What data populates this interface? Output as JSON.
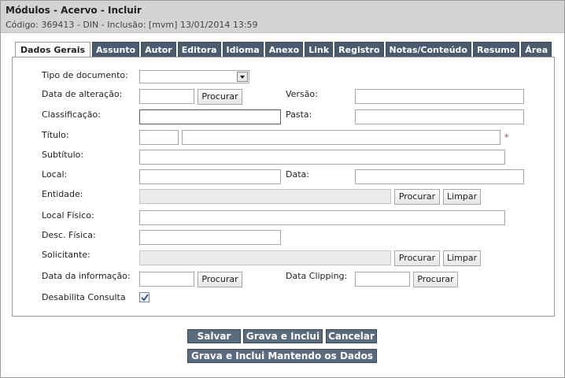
{
  "header": {
    "title": "Módulos - Acervo - Incluir",
    "subtitle": "Código: 369413 - DIN - Inclusão: [mvm] 13/01/2014 13:59"
  },
  "tabs": [
    {
      "label": "Dados Gerais",
      "active": true
    },
    {
      "label": "Assunto"
    },
    {
      "label": "Autor"
    },
    {
      "label": "Editora"
    },
    {
      "label": "Idioma"
    },
    {
      "label": "Anexo"
    },
    {
      "label": "Link"
    },
    {
      "label": "Registro"
    },
    {
      "label": "Notas/Conteúdo"
    },
    {
      "label": "Resumo"
    },
    {
      "label": "Área"
    }
  ],
  "form": {
    "tipo_documento": {
      "label": "Tipo de documento:",
      "value": ""
    },
    "data_alteracao": {
      "label": "Data de alteração:",
      "value": "",
      "button": "Procurar"
    },
    "versao": {
      "label": "Versão:",
      "value": ""
    },
    "classificacao": {
      "label": "Classificação:",
      "value": ""
    },
    "pasta": {
      "label": "Pasta:",
      "value": ""
    },
    "titulo": {
      "label": "Título:",
      "prefix": "",
      "value": "",
      "required_mark": "*"
    },
    "subtitulo": {
      "label": "Subtítulo:",
      "value": ""
    },
    "local": {
      "label": "Local:",
      "value": ""
    },
    "data": {
      "label": "Data:",
      "value": ""
    },
    "entidade": {
      "label": "Entidade:",
      "value": "",
      "search_button": "Procurar",
      "clear_button": "Limpar"
    },
    "local_fisico": {
      "label": "Local Físico:",
      "value": ""
    },
    "desc_fisica": {
      "label": "Desc. Física:",
      "value": ""
    },
    "solicitante": {
      "label": "Solicitante:",
      "value": "",
      "search_button": "Procurar",
      "clear_button": "Limpar"
    },
    "data_informacao": {
      "label": "Data da informação:",
      "value": "",
      "button": "Procurar"
    },
    "data_clipping": {
      "label": "Data Clipping:",
      "value": "",
      "button": "Procurar"
    },
    "desabilita_consulta": {
      "label": "Desabilita Consulta",
      "checked": true
    }
  },
  "actions": {
    "salvar": "Salvar",
    "grava_inclui": "Grava e Inclui",
    "cancelar": "Cancelar",
    "grava_inclui_mantendo": "Grava e Inclui Mantendo os Dados"
  },
  "colors": {
    "header_bg": "#d4d4d4",
    "tab_bg": "#4a5b6e",
    "action_button_bg": "#5a6b7d",
    "required_mark": "#dd2233",
    "checkbox_check": "#2b4a80"
  },
  "icons": {
    "dropdown": "chevron-down-icon",
    "checkbox": "checkmark-icon"
  }
}
